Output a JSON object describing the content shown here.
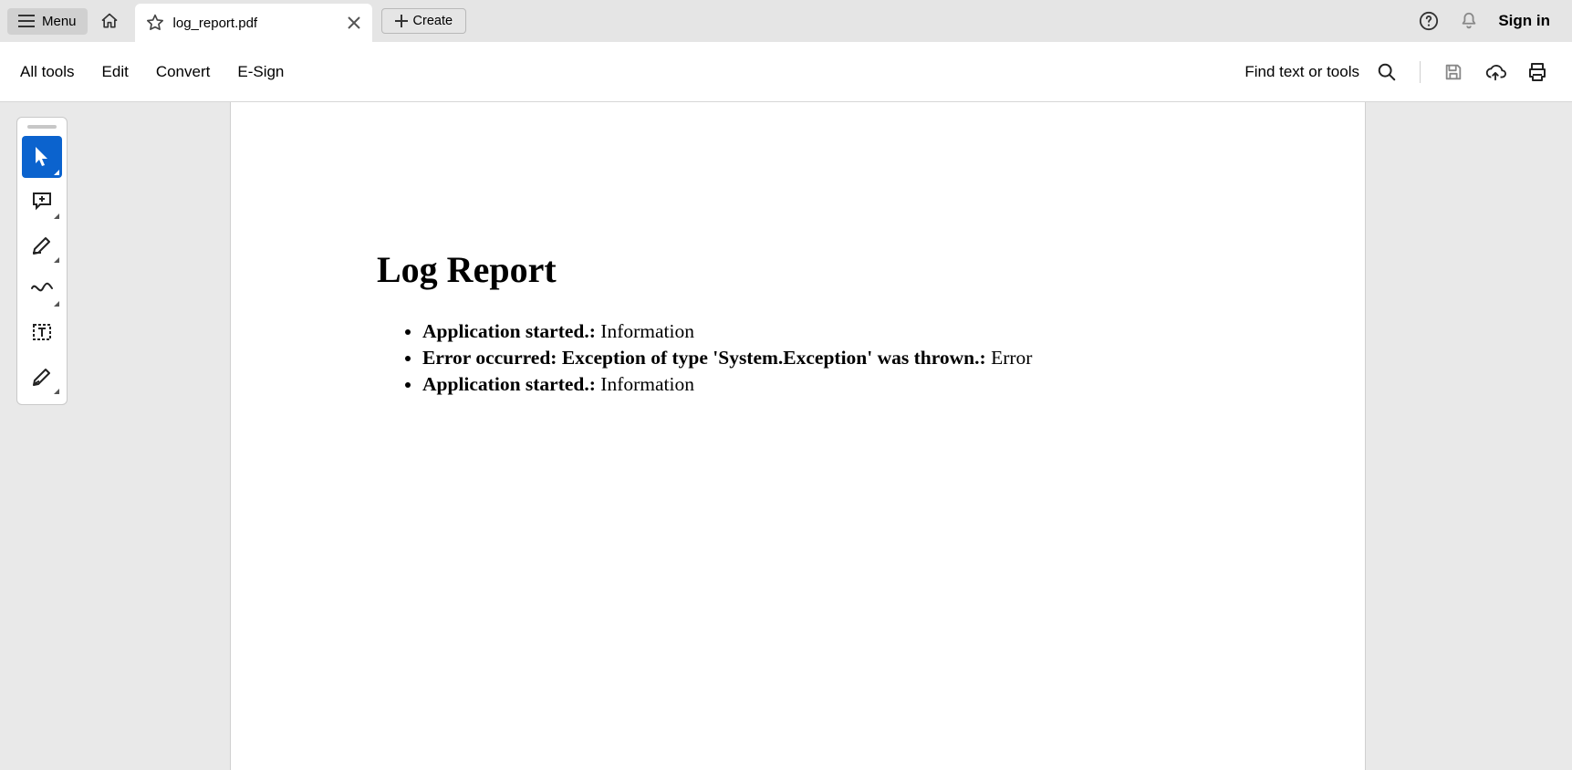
{
  "titlebar": {
    "menu_label": "Menu",
    "tab_title": "log_report.pdf",
    "create_label": "Create",
    "signin_label": "Sign in"
  },
  "toolbar": {
    "items": [
      "All tools",
      "Edit",
      "Convert",
      "E-Sign"
    ],
    "find_label": "Find text or tools"
  },
  "document": {
    "title": "Log Report",
    "entries": [
      {
        "bold": "Application started.:",
        "rest": " Information"
      },
      {
        "bold": "Error occurred: Exception of type 'System.Exception' was thrown.:",
        "rest": " Error"
      },
      {
        "bold": "Application started.:",
        "rest": " Information"
      }
    ]
  }
}
